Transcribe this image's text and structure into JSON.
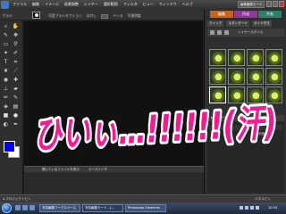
{
  "menubar": {
    "items": [
      "ファイル",
      "編集",
      "イメージ",
      "画質調整",
      "レイヤー",
      "選択範囲",
      "フィルタ",
      "ビュー",
      "ウィンドウ",
      "ヘルプ"
    ],
    "mode_button": "画像管理モード"
  },
  "options": {
    "tool_label": "ブラシ",
    "mode_label": "可変ブラシオプション",
    "size_label": "ぼかし",
    "size_value": "ベース",
    "mode_value": "不透明度"
  },
  "right_panel": {
    "tabs": [
      "編集",
      "作成",
      "共有"
    ],
    "sub_tabs": [
      "クイック",
      "スタンダード",
      "ガイド付き"
    ],
    "effects_label": "レイヤースタイル",
    "layers_label": "▸ レイヤー",
    "opacity_label": "不透明度"
  },
  "bin": {
    "tabs": [
      "開いているファイルを表示",
      "オーガナイザ"
    ]
  },
  "status": {
    "left": "◂ プロジェクトビン",
    "right": "パネルビン"
  },
  "taskbar": {
    "tasks": [
      "写真編集ワークスペース",
      "写真編集モード - [...",
      "Photoshop Elements"
    ],
    "time": "10:54"
  },
  "overlay": {
    "text": "ひいぃ…!!!!!!(汗)",
    "fill_color": "#ff1493",
    "stroke_color": "#ffffff"
  },
  "colors": {
    "foreground": "#0000ff",
    "background": "#ffffff",
    "edit_tab": "#c8621f",
    "create_tab": "#8d3a9a",
    "share_tab": "#2f7e6a"
  }
}
